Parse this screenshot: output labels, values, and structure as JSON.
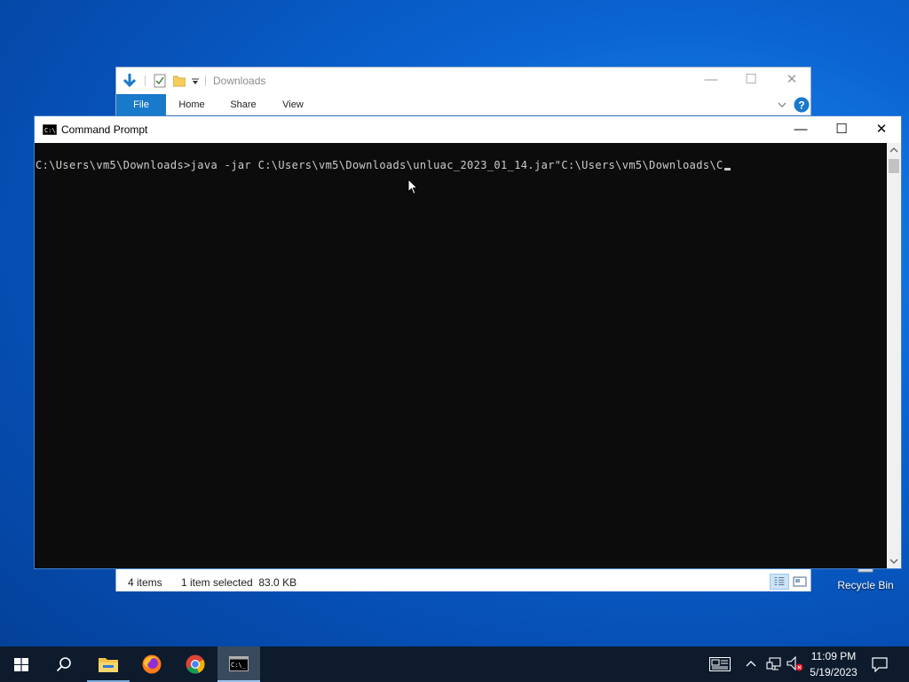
{
  "desktop": {
    "recycle_bin_label": "Recycle Bin"
  },
  "explorer": {
    "title": "Downloads",
    "tabs": [
      {
        "label": "File",
        "active": true
      },
      {
        "label": "Home"
      },
      {
        "label": "Share"
      },
      {
        "label": "View"
      }
    ],
    "status": {
      "items": "4 items",
      "selected": "1 item selected  83.0 KB"
    },
    "icons": [
      "download-arrow-icon",
      "properties-icon",
      "folder-icon",
      "dropdown-icon",
      "chevron-down-icon",
      "help-icon",
      "details-view-icon",
      "tiles-view-icon"
    ]
  },
  "cmd": {
    "title": "Command Prompt",
    "line": "C:\\Users\\vm5\\Downloads>java -jar C:\\Users\\vm5\\Downloads\\unluac_2023_01_14.jar\"C:\\Users\\vm5\\Downloads\\C"
  },
  "taskbar": {
    "apps": [
      "start-icon",
      "search-icon",
      "file-explorer-icon",
      "firefox-icon",
      "chrome-icon",
      "command-prompt-icon"
    ],
    "clock": {
      "time": "11:09 PM",
      "date": "5/19/2023"
    }
  },
  "colors": {
    "accent": "#1979ca",
    "console_bg": "#0c0c0c",
    "console_text": "#cccccc",
    "taskbar": "#0d1b2d"
  }
}
